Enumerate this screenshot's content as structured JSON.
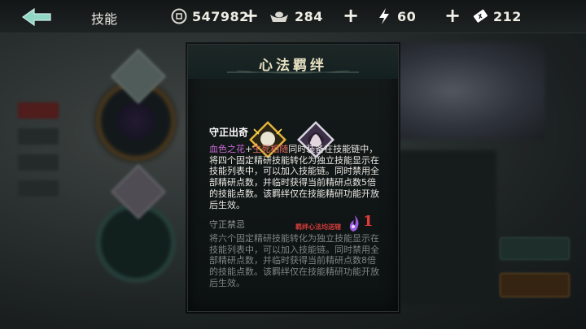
{
  "header": {
    "title": "技能",
    "back_icon": "back-arrow-icon"
  },
  "resources": [
    {
      "icon": "coin-icon",
      "value": "547982",
      "color": "#d8d8d0"
    },
    {
      "icon": "ingot-icon",
      "value": "284",
      "color": "#d8d8d0"
    },
    {
      "icon": "lightning-icon",
      "value": "60",
      "color": "#ffffff"
    },
    {
      "icon": "ticket-icon",
      "value": "212",
      "color": "#ffffff"
    }
  ],
  "modal": {
    "title": "心法羁绊",
    "bond_icons": [
      "portrait-gold-icon",
      "portrait-purple-icon"
    ],
    "bond1": {
      "name": "守正出奇",
      "tag1": "血色之花",
      "plus": "+",
      "tag2": "生死相随",
      "text": "同时装备在技能链中，将四个固定精研技能转化为独立技能显示在技能列表中，可以加入技能链。同时禁用全部精研点数，并临时获得当前精研点数5倍的技能点数。该羁绊仅在技能精研功能开放后生效。"
    },
    "bond2": {
      "name": "守正禁忌",
      "note": "羁绊心法均送辖",
      "count": "1",
      "text": "将六个固定精研技能转化为独立技能显示在技能列表中，可以加入技能链。同时禁用全部精研点数，并临时获得当前精研点数8倍的技能点数。该羁绊仅在技能精研功能开放后生效。"
    }
  },
  "colors": {
    "accent_gold": "#d9a93a",
    "accent_purple": "#c96ad6",
    "accent_red": "#e06a5e",
    "count_red": "#e13c3c"
  }
}
